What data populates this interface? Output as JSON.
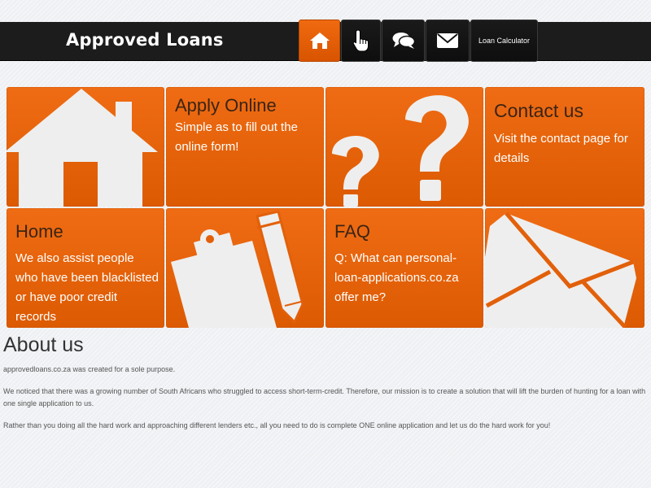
{
  "navbar": {
    "brand": "Approved Loans",
    "items": [
      {
        "icon": "home-icon",
        "active": true
      },
      {
        "icon": "hand-pointer-icon",
        "active": false
      },
      {
        "icon": "chat-bubbles-icon",
        "active": false
      },
      {
        "icon": "envelope-icon",
        "active": false
      },
      {
        "label": "Loan Calculator",
        "active": false
      }
    ]
  },
  "tiles": [
    {
      "type": "icon",
      "icon": "house-icon"
    },
    {
      "type": "text",
      "title": "Apply Online",
      "text": "Simple as to fill out the online form!"
    },
    {
      "type": "icon",
      "icon": "question-marks-icon"
    },
    {
      "type": "text",
      "title": "Contact us",
      "text": "Visit the contact page for details"
    },
    {
      "type": "text",
      "title": "Home",
      "text": "We also assist people who have been blacklisted or have poor credit records"
    },
    {
      "type": "icon",
      "icon": "clipboard-pencil-icon"
    },
    {
      "type": "text",
      "title": "FAQ",
      "text": "Q: What can personal-loan-applications.co.za offer me?"
    },
    {
      "type": "icon",
      "icon": "envelope-icon"
    }
  ],
  "about": {
    "heading": "About us",
    "paragraphs": [
      "approvedloans.co.za was created for a sole purpose.",
      "We noticed that there was a growing number of South Africans who struggled to access short-term-credit.  Therefore, our mission is to create a solution that will lift the burden of hunting for a loan with one single application to us.",
      "Rather than you doing all the hard work and approaching different lenders etc., all you need to do is complete ONE online application and let us do the hard work for you!"
    ]
  },
  "colors": {
    "accent": "#e8620a",
    "navbar": "#1c1c1c",
    "tile_title": "#3b2414"
  }
}
